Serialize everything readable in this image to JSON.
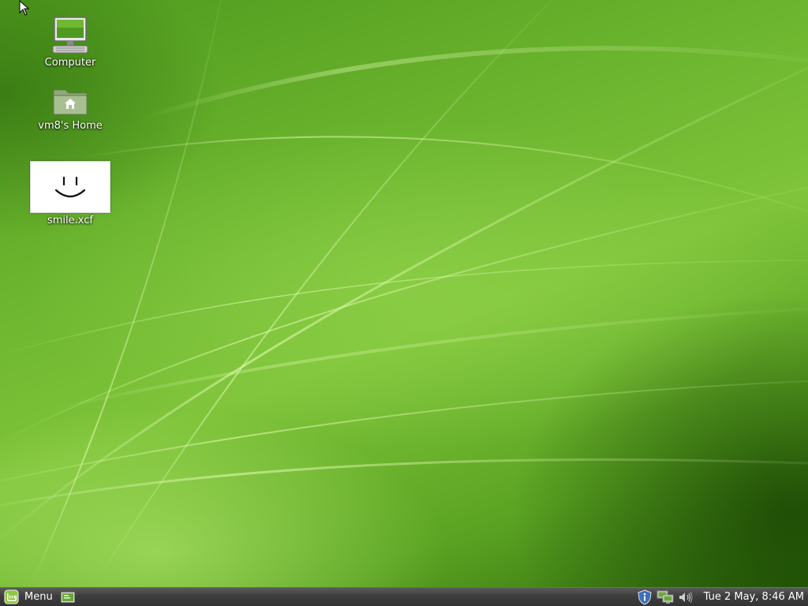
{
  "desktop": {
    "icons": [
      {
        "label": "Computer",
        "icon": "computer-icon"
      },
      {
        "label": "vm8's Home",
        "icon": "home-folder-icon"
      },
      {
        "label": "smile.xcf",
        "icon": "image-thumbnail-icon"
      }
    ],
    "wallpaper_colors": {
      "base": "#6db62f",
      "light": "#bff07a",
      "dark": "#2f6a0c"
    }
  },
  "panel": {
    "menu_label": "Menu",
    "menu_icon": "linux-mint-logo-icon",
    "show_desktop_icon": "show-desktop-icon",
    "tray_icons": [
      "update-manager-shield-icon",
      "network-icon",
      "volume-icon"
    ],
    "clock": "Tue  2 May,  8:46 AM",
    "colors": {
      "panel_bg": "#3e3e3e",
      "mint_green": "#8dc63f"
    }
  }
}
